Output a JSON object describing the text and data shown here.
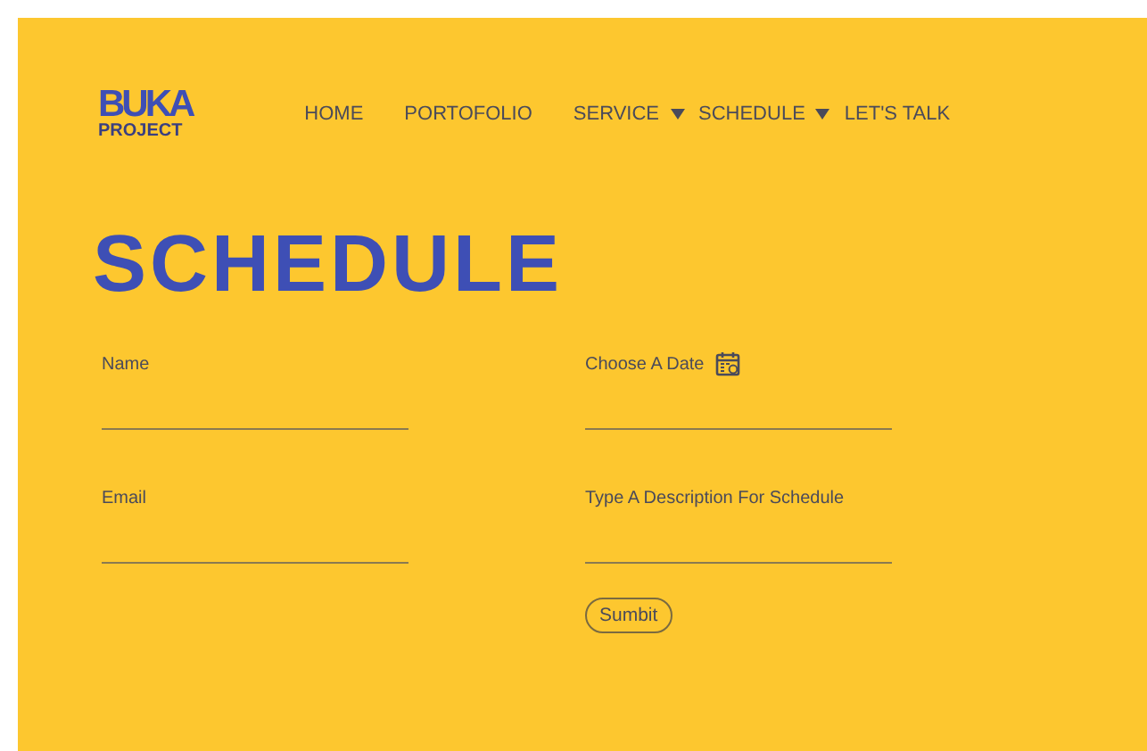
{
  "logo": {
    "title": "BUKA",
    "subtitle": "PROJECT"
  },
  "nav": [
    {
      "label": "HOME",
      "dropdown": false
    },
    {
      "label": "PORTOFOLIO",
      "dropdown": false
    },
    {
      "label": "SERVICE",
      "dropdown": true
    },
    {
      "label": "SCHEDULE",
      "dropdown": true
    },
    {
      "label": "LET'S TALK",
      "dropdown": false
    }
  ],
  "heading": "SCHEDULE",
  "form": {
    "columns": [
      [
        {
          "label": "Name",
          "kind": "text"
        },
        {
          "label": "Email",
          "kind": "text"
        }
      ],
      [
        {
          "label": "Choose A Date",
          "kind": "date"
        },
        {
          "label": "Type A Description For Schedule",
          "kind": "text"
        }
      ]
    ],
    "submit": "Sumbit"
  }
}
